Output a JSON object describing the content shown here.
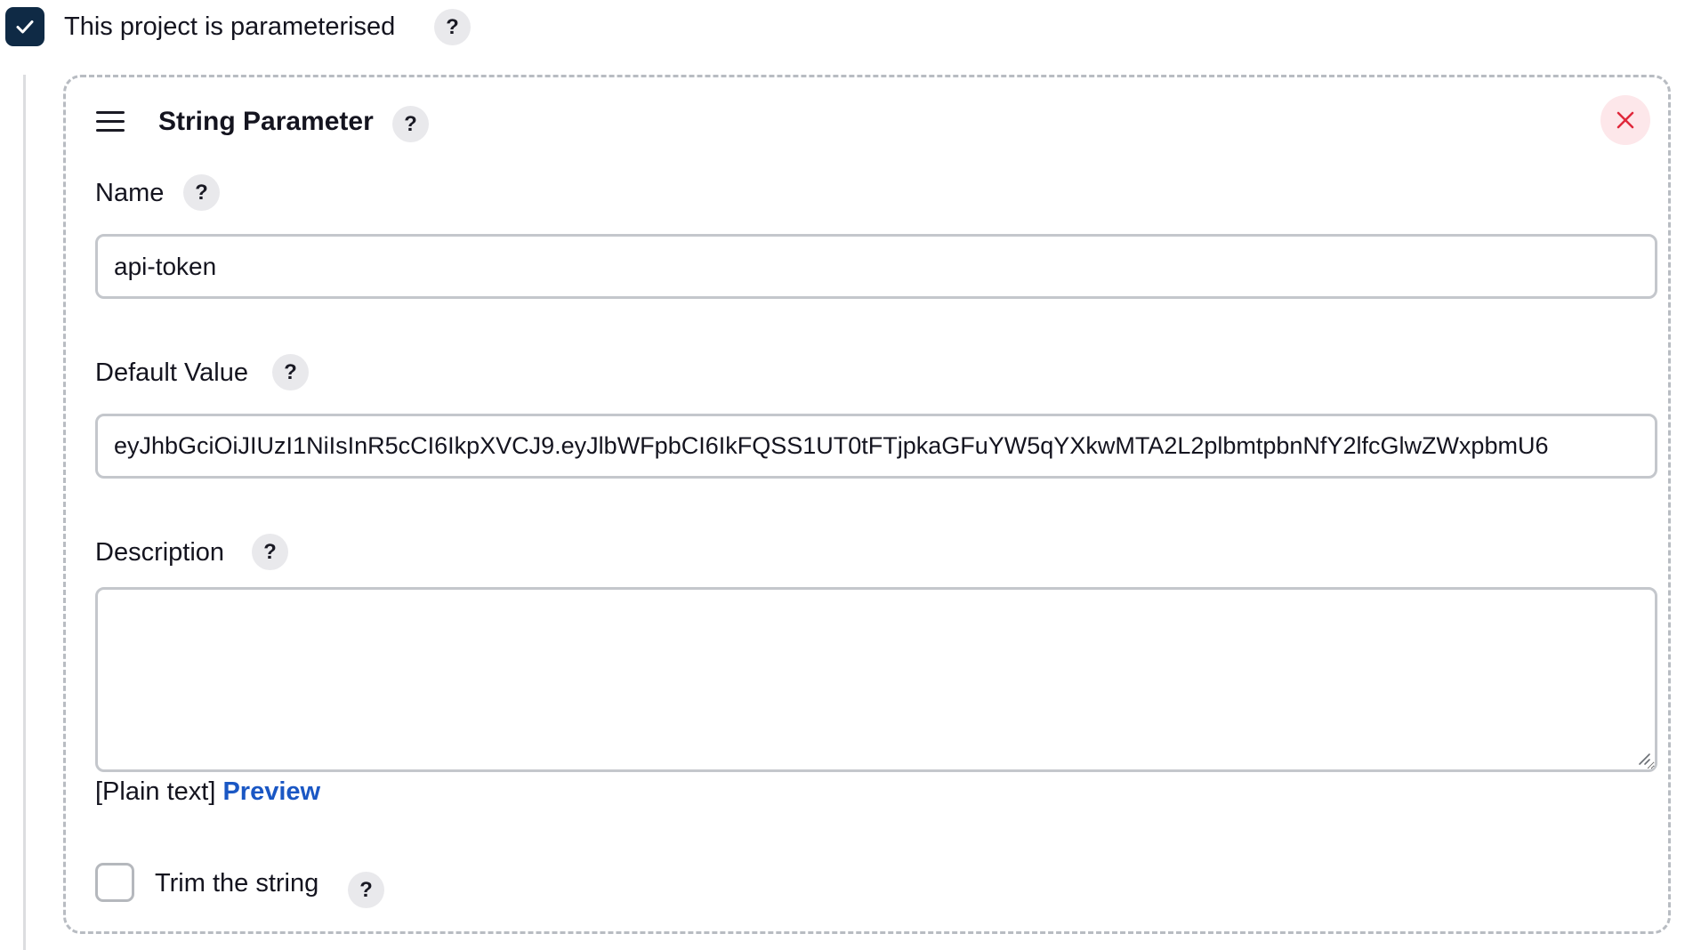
{
  "header": {
    "parameterised_label": "This project is parameterised",
    "parameterised_checked": true,
    "help_glyph": "?"
  },
  "parameter": {
    "title": "String Parameter",
    "help_glyph": "?",
    "name": {
      "label": "Name",
      "value": "api-token"
    },
    "default_value": {
      "label": "Default Value",
      "value": "eyJhbGciOiJIUzI1NiIsInR5cCI6IkpXVCJ9.eyJlbWFpbCI6IkFQSS1UT0tFTjpkaGFuYW5qYXkwMTA2L2plbmtpbnNfY2lfcGlwZWxpbmU6"
    },
    "description": {
      "label": "Description",
      "value": ""
    },
    "format": {
      "plain_text": "[Plain text]",
      "preview_link": "Preview"
    },
    "trim": {
      "label": "Trim the string",
      "checked": false
    }
  },
  "icons": {
    "checkbox_checked": "check-icon",
    "drag": "drag-handle-icon",
    "close": "close-icon",
    "help": "help-icon"
  },
  "colors": {
    "checkbox_fill": "#0f2a45",
    "close_bg": "#fde7ea",
    "close_x": "#e0283b",
    "link": "#1a57c4",
    "help_bg": "#e9e9ec",
    "border": "#c4c7cc"
  }
}
